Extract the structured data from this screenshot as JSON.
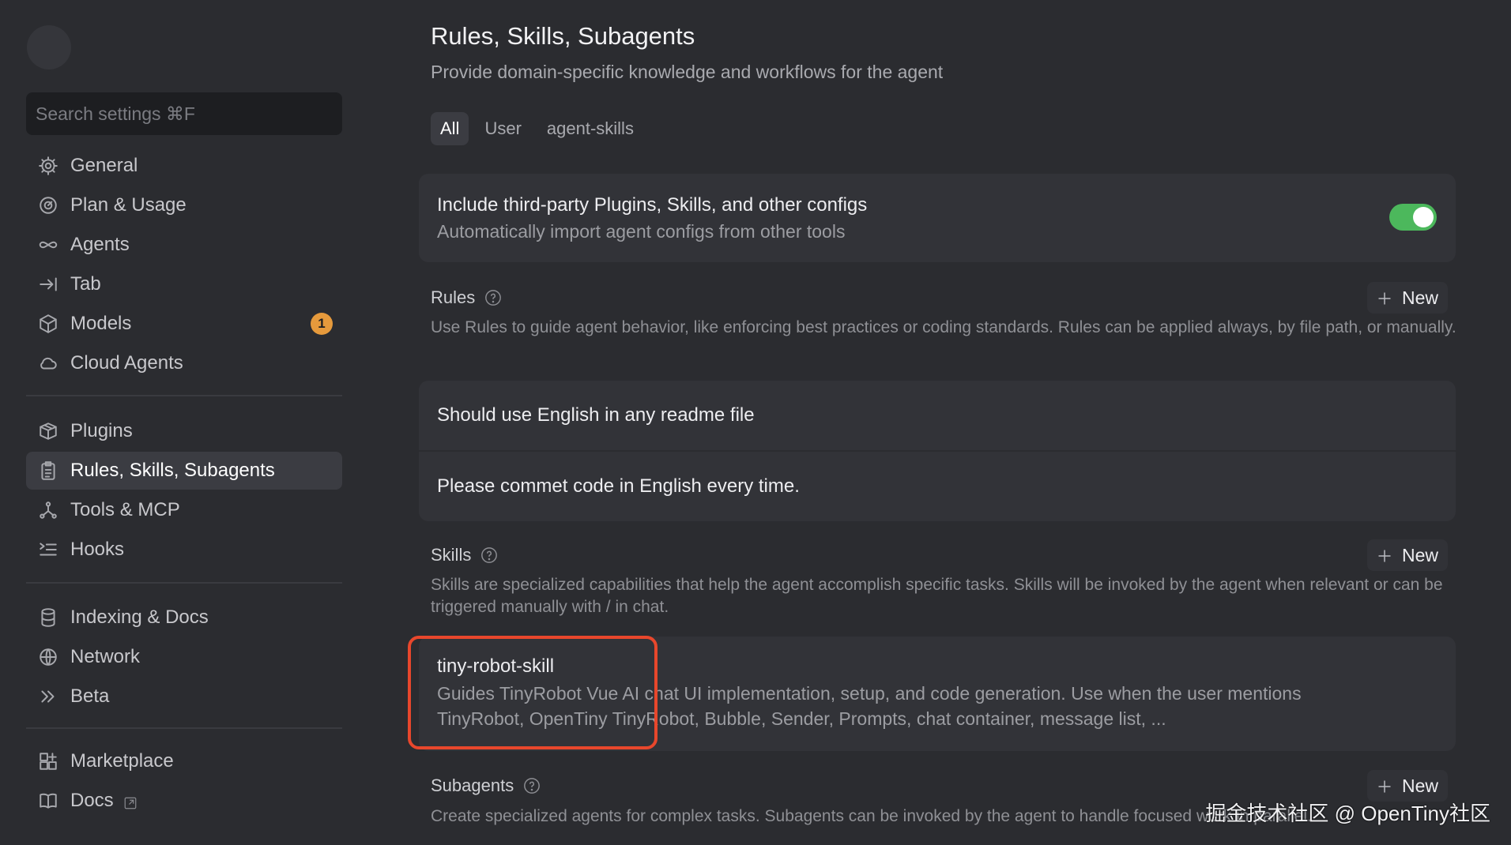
{
  "sidebar": {
    "search_placeholder": "Search settings ⌘F",
    "groups": [
      {
        "items": [
          {
            "label": "General",
            "icon": "gear-icon"
          },
          {
            "label": "Plan & Usage",
            "icon": "gauge-icon"
          },
          {
            "label": "Agents",
            "icon": "infinity-icon"
          },
          {
            "label": "Tab",
            "icon": "arrow-right-bar-icon"
          },
          {
            "label": "Models",
            "icon": "cube-icon",
            "badge": "1"
          },
          {
            "label": "Cloud Agents",
            "icon": "cloud-icon"
          }
        ]
      },
      {
        "items": [
          {
            "label": "Plugins",
            "icon": "package-icon"
          },
          {
            "label": "Rules, Skills, Subagents",
            "icon": "clipboard-icon",
            "active": true
          },
          {
            "label": "Tools & MCP",
            "icon": "nodes-icon"
          },
          {
            "label": "Hooks",
            "icon": "hooks-list-icon"
          }
        ]
      },
      {
        "items": [
          {
            "label": "Indexing & Docs",
            "icon": "database-icon"
          },
          {
            "label": "Network",
            "icon": "globe-icon"
          },
          {
            "label": "Beta",
            "icon": "double-chevron-icon"
          }
        ]
      },
      {
        "items": [
          {
            "label": "Marketplace",
            "icon": "grid-plus-icon"
          },
          {
            "label": "Docs",
            "icon": "book-icon",
            "external": true
          }
        ]
      }
    ]
  },
  "main": {
    "title": "Rules, Skills, Subagents",
    "subtitle": "Provide domain-specific knowledge and workflows for the agent",
    "tabs": [
      "All",
      "User",
      "agent-skills"
    ],
    "active_tab": "All",
    "third_party": {
      "title": "Include third-party Plugins, Skills, and other configs",
      "desc": "Automatically import agent configs from other tools",
      "enabled": true,
      "toggle_color": "#4cb85c"
    },
    "rules": {
      "heading": "Rules",
      "new_label": "New",
      "desc": "Use Rules to guide agent behavior, like enforcing best practices or coding standards. Rules can be applied always, by file path, or manually.",
      "items": [
        "Should use English in any readme file",
        "Please commet code in English every time."
      ]
    },
    "skills": {
      "heading": "Skills",
      "new_label": "New",
      "desc": "Skills are specialized capabilities that help the agent accomplish specific tasks. Skills will be invoked by the agent when relevant or can be triggered manually with / in chat.",
      "items": [
        {
          "name": "tiny-robot-skill",
          "desc": "Guides TinyRobot Vue AI chat UI implementation, setup, and code generation. Use when the user mentions TinyRobot, OpenTiny TinyRobot, Bubble, Sender, Prompts, chat container, message list, ..."
        }
      ]
    },
    "subagents": {
      "heading": "Subagents",
      "new_label": "New",
      "desc": "Create specialized agents for complex tasks. Subagents can be invoked by the agent to handle focused work in parallel."
    }
  },
  "watermark": "掘金技术社区 @ OpenTiny社区",
  "colors": {
    "highlight": "#e8472c",
    "badge": "#e69a3c"
  }
}
